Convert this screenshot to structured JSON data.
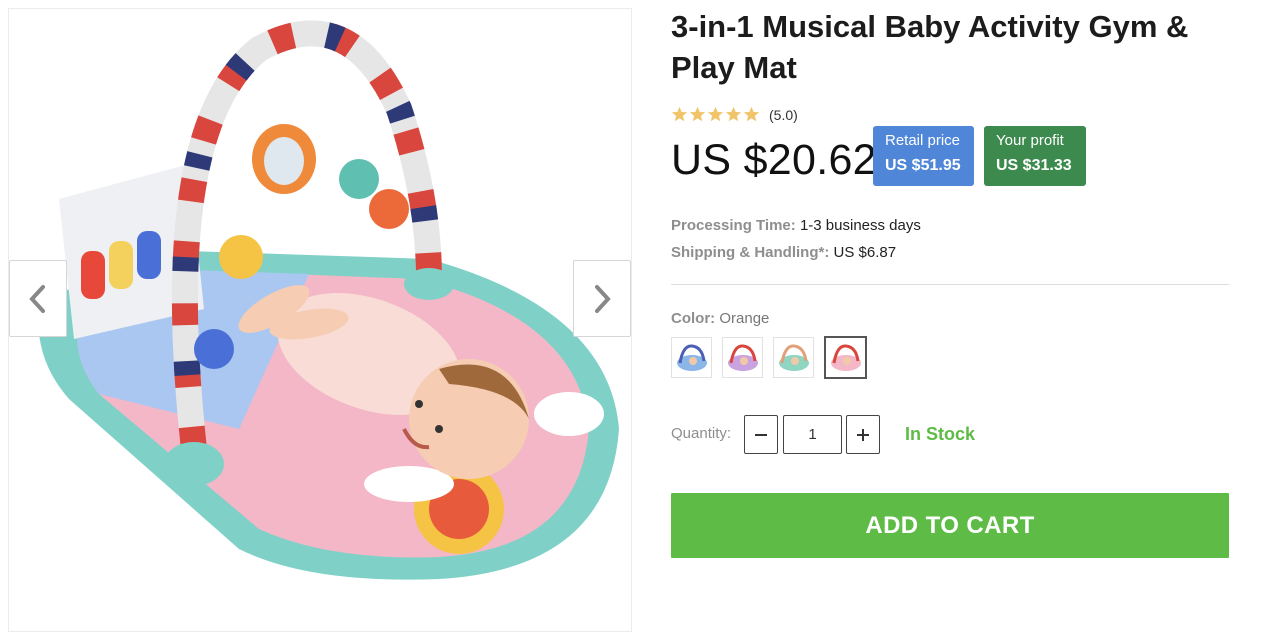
{
  "product": {
    "title": "3-in-1 Musical Baby Activity Gym & Play Mat",
    "rating_text": "(5.0)",
    "rating_value": 5,
    "price": "US $20.62",
    "retail": {
      "label": "Retail price",
      "value": "US $51.95"
    },
    "profit": {
      "label": "Your profit",
      "value": "US $31.33"
    }
  },
  "shipping": {
    "processing_label": "Processing Time:",
    "processing_value": "1-3 business days",
    "handling_label": "Shipping & Handling*:",
    "handling_value": "US $6.87"
  },
  "variant": {
    "color_label": "Color:",
    "color_value": "Orange",
    "swatches": [
      "variant-1",
      "variant-2",
      "variant-3",
      "Orange"
    ]
  },
  "quantity": {
    "label": "Quantity:",
    "value": "1",
    "minus_icon": "minus-icon",
    "plus_icon": "plus-icon"
  },
  "stock_status": "In Stock",
  "cart_button": "ADD TO CART",
  "icons": {
    "prev": "chevron-left-icon",
    "next": "chevron-right-icon",
    "star": "star-icon"
  },
  "colors": {
    "accent_green": "#5dbb46",
    "retail_blue": "#4f86d8",
    "profit_green": "#3c8a4e",
    "star": "#f2c46a"
  }
}
